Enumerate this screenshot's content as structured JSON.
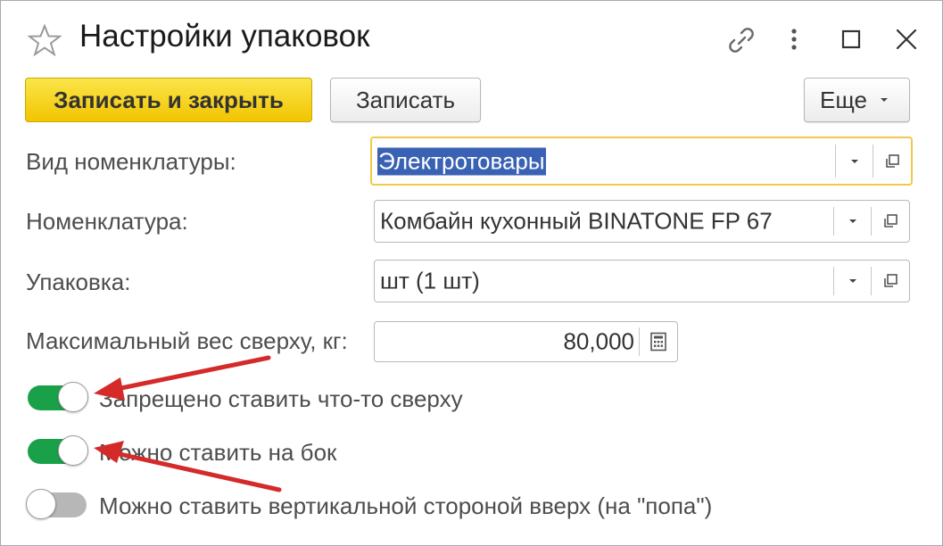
{
  "window": {
    "title": "Настройки упаковок",
    "icons": [
      "star-icon",
      "link-icon",
      "more-vertical-icon",
      "maximize-icon",
      "close-icon"
    ]
  },
  "toolbar": {
    "save_close_label": "Записать и закрыть",
    "save_label": "Записать",
    "more_label": "Еще"
  },
  "form": {
    "vid": {
      "label": "Вид номенклатуры:",
      "value": "Электротовары"
    },
    "nomenclature": {
      "label": "Номенклатура:",
      "value": "Комбайн кухонный BINATONE FP 67"
    },
    "package": {
      "label": "Упаковка:",
      "value": "шт (1 шт)"
    },
    "max_weight": {
      "label": "Максимальный вес сверху, кг:",
      "value": "80,000"
    }
  },
  "toggles": [
    {
      "label": "Запрещено ставить что-то сверху",
      "state": "on"
    },
    {
      "label": "Можно ставить на бок",
      "state": "on"
    },
    {
      "label": "Можно ставить вертикальной стороной вверх (на \"попа\")",
      "state": "off"
    }
  ],
  "colors": {
    "accent_yellow": "#f1c500",
    "toggle_on": "#1aa048",
    "annotation_arrow": "#d42a2a",
    "selection": "#3a62b4"
  }
}
